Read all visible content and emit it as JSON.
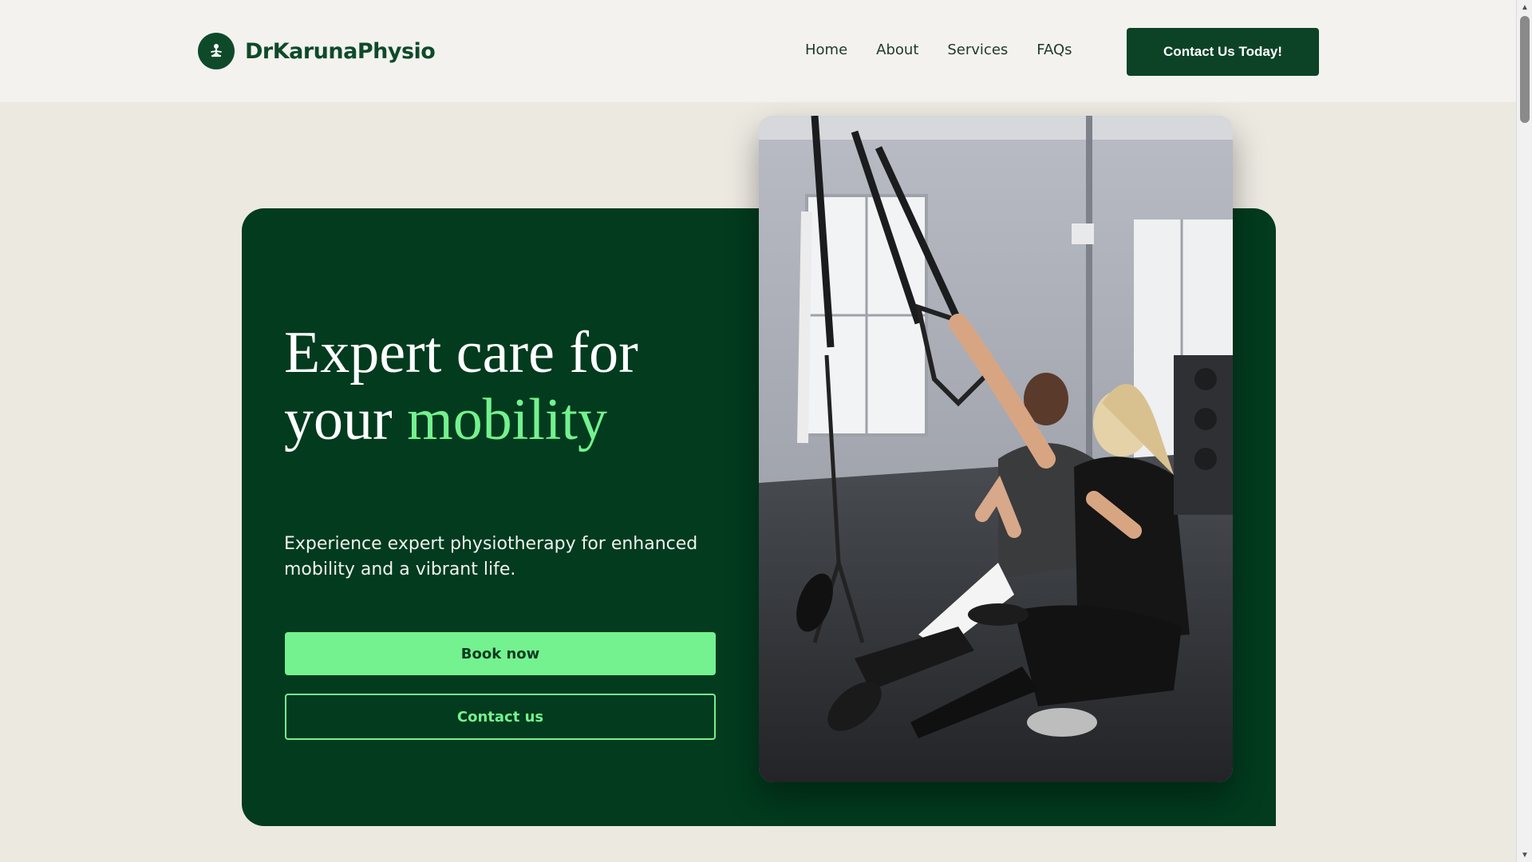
{
  "brand": {
    "name": "DrKarunaPhysio",
    "icon": "meditation-person-icon"
  },
  "nav": {
    "items": [
      {
        "label": "Home"
      },
      {
        "label": "About"
      },
      {
        "label": "Services"
      },
      {
        "label": "FAQs"
      }
    ],
    "cta_label": "Contact Us Today!"
  },
  "hero": {
    "title_line1": "Expert care for",
    "title_line2_prefix": "your ",
    "title_accent": "mobility",
    "description": "Experience expert physiotherapy for enhanced mobility and a vibrant life.",
    "primary_button": "Book now",
    "secondary_button": "Contact us",
    "image": "gym-physiotherapy-training-photo"
  },
  "colors": {
    "brand_dark": "#023b1e",
    "accent_green": "#74f28f",
    "page_bg": "#ece9e1",
    "header_bg": "#f4f2ee"
  }
}
